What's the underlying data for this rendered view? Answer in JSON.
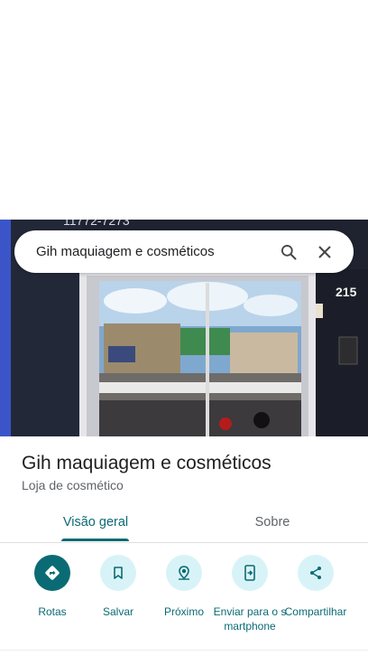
{
  "search": {
    "query": "Gih maquiagem e cosméticos"
  },
  "photo": {
    "street_number": "215",
    "phone_fragment": "11772-7273"
  },
  "place": {
    "name": "Gih maquiagem e cosméticos",
    "category": "Loja de cosmético"
  },
  "tabs": [
    {
      "label": "Visão geral",
      "selected": true
    },
    {
      "label": "Sobre",
      "selected": false
    }
  ],
  "actions": [
    {
      "label": "Rotas",
      "icon": "directions-icon"
    },
    {
      "label": "Salvar",
      "icon": "bookmark-icon"
    },
    {
      "label": "Próximo",
      "icon": "nearby-icon"
    },
    {
      "label": "Enviar para o smartphone",
      "icon": "send-to-phone-icon"
    },
    {
      "label": "Compartilhar",
      "icon": "share-icon"
    }
  ],
  "colors": {
    "accent": "#0b6b74",
    "chip_bg": "#d8f3f8"
  }
}
